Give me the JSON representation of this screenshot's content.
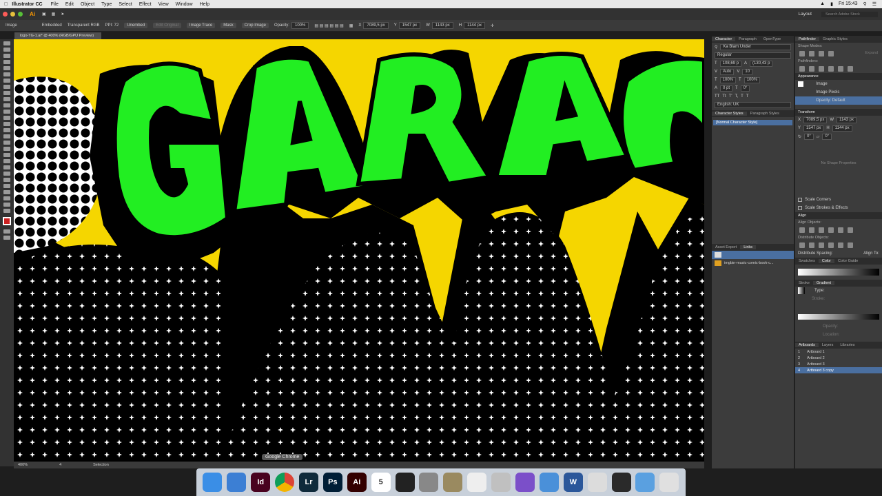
{
  "menubar": {
    "app": "Illustrator CC",
    "items": [
      "File",
      "Edit",
      "Object",
      "Type",
      "Select",
      "Effect",
      "View",
      "Window",
      "Help"
    ],
    "clock": "Fri 15:43"
  },
  "approw": {
    "workspace": "Layout",
    "search_placeholder": "Search Adobe Stock"
  },
  "controlbar": {
    "selection": "Image",
    "embedded": "Embedded",
    "color_mode": "Transparent RGB",
    "ppi": "PPI: 72",
    "unembed": "Unembed",
    "edit_original": "Edit Original",
    "image_trace": "Image Trace",
    "mask": "Mask",
    "crop_image": "Crop Image",
    "opacity_label": "Opacity:",
    "opacity_value": "100%",
    "x": "7089,5 px",
    "y": "1547 px",
    "w": "1143 px",
    "h": "1144 px"
  },
  "document": {
    "tab": "logo-TG-1.ai* @ 400% (RGB/GPU Preview)",
    "zoom": "400%",
    "artboard_num": "4",
    "tool": "Selection"
  },
  "canvas": {
    "word": "GARAC",
    "colors": {
      "green": "#22ee22",
      "yellow": "#f5d600",
      "black": "#000000"
    }
  },
  "character": {
    "tabs": [
      "Character",
      "Paragraph",
      "OpenType"
    ],
    "font": "Ka Blam Under",
    "style": "Regular",
    "size": "108,69 p",
    "leading": "(130,43 p",
    "kerning": "Auto",
    "tracking": "10",
    "vscale": "100%",
    "hscale": "100%",
    "baseline": "0 pt",
    "rotate": "0°",
    "language": "English: UK"
  },
  "char_styles": {
    "tabs": [
      "Character Styles",
      "Paragraph Styles"
    ],
    "item": "[Normal Character Style]"
  },
  "links": {
    "tabs": [
      "Asset Export",
      "Links"
    ],
    "file": "imgbin-music-comic-book-c..."
  },
  "pathfinder": {
    "tabs": [
      "Pathfinder",
      "Graphic Styles"
    ],
    "shape_modes": "Shape Modes:",
    "expand": "Expand",
    "pathfinders": "Pathfinders:"
  },
  "appearance": {
    "title": "Appearance",
    "item": "Image",
    "pixels": "Image Pixels",
    "opacity": "Opacity: Default"
  },
  "transform": {
    "title": "Transform",
    "x": "7089,5 px",
    "y": "1547 px",
    "w": "1143 px",
    "h": "1144 px",
    "angle": "0°",
    "shear": "0°",
    "no_shape": "No Shape Properties",
    "scale_corners": "Scale Corners",
    "scale_strokes": "Scale Strokes & Effects"
  },
  "align": {
    "title": "Align",
    "objects": "Align Objects:",
    "distribute": "Distribute Objects:",
    "spacing": "Distribute Spacing:",
    "align_to": "Align To:"
  },
  "color": {
    "tabs": [
      "Swatches",
      "Color",
      "Color Guide"
    ]
  },
  "stroke": {
    "tabs": [
      "Stroke",
      "Gradient"
    ],
    "type": "Type:",
    "stroke_label": "Stroke:",
    "opacity": "Opacity:",
    "location": "Location:"
  },
  "artboards": {
    "tabs": [
      "Artboards",
      "Layers",
      "Libraries"
    ],
    "rows": [
      {
        "n": "1",
        "name": "Artboard 1"
      },
      {
        "n": "2",
        "name": "Artboard 2"
      },
      {
        "n": "3",
        "name": "Artboard 3"
      },
      {
        "n": "4",
        "name": "Artboard 3 copy"
      }
    ]
  },
  "dock": {
    "tooltip": "Google Chrome",
    "apps": [
      {
        "name": "Finder",
        "label": "",
        "color": "#3a8ee6"
      },
      {
        "name": "Mail",
        "label": "",
        "color": "#3c7fd4"
      },
      {
        "name": "InDesign",
        "label": "Id",
        "color": "#49021f"
      },
      {
        "name": "Chrome",
        "label": "",
        "color": "#ffffff"
      },
      {
        "name": "Lightroom",
        "label": "Lr",
        "color": "#0f2a3b"
      },
      {
        "name": "Photoshop",
        "label": "Ps",
        "color": "#001e36"
      },
      {
        "name": "Illustrator",
        "label": "Ai",
        "color": "#330000"
      },
      {
        "name": "Calendar",
        "label": "5",
        "color": "#ffffff"
      },
      {
        "name": "Acrobat",
        "label": "",
        "color": "#222222"
      },
      {
        "name": "System Preferences",
        "label": "",
        "color": "#888888"
      },
      {
        "name": "Notes",
        "label": "",
        "color": "#9a8a60"
      },
      {
        "name": "TextEdit",
        "label": "",
        "color": "#eeeeee"
      },
      {
        "name": "Preview",
        "label": "",
        "color": "#c0c0c0"
      },
      {
        "name": "Viber",
        "label": "",
        "color": "#7b4fc9"
      },
      {
        "name": "Maps",
        "label": "",
        "color": "#4a90d9"
      },
      {
        "name": "Word",
        "label": "W",
        "color": "#2b579a"
      },
      {
        "name": "Photos",
        "label": "",
        "color": "#dcdcdc"
      },
      {
        "name": "QuickTime",
        "label": "",
        "color": "#2a2a2a"
      },
      {
        "name": "Applications",
        "label": "",
        "color": "#5aa0e0"
      },
      {
        "name": "Trash",
        "label": "",
        "color": "#e0e0e0"
      }
    ]
  }
}
